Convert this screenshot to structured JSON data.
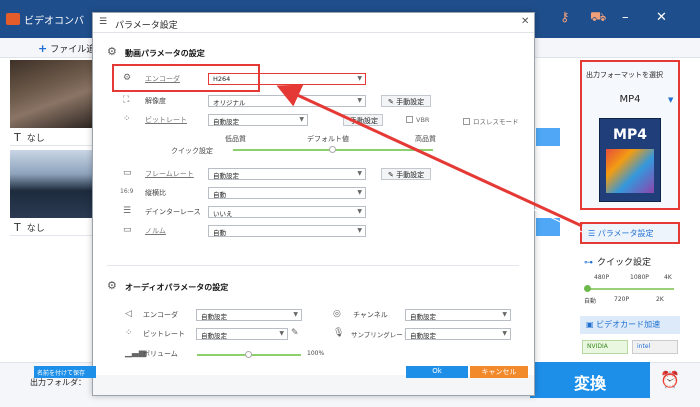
{
  "app": {
    "title": "ビデオコンバ",
    "add_file": "ファイル追",
    "item_label": "なし",
    "t_glyph": "T",
    "output_folder": "出力フォルダ："
  },
  "right_panel": {
    "format_label": "出力フォーマットを選択",
    "format_value": "MP4",
    "format_icon_text": "MP4",
    "param_button": "パラメータ設定",
    "quick_label": "クイック設定",
    "quick_top": [
      "480P",
      "1080P",
      "4K"
    ],
    "quick_bottom": [
      "自動",
      "720P",
      "2K"
    ],
    "accel_label": "ビデオカード加速",
    "gpu1": "NVIDIA",
    "gpu2": "intel",
    "convert": "変換"
  },
  "dialog": {
    "title": "パラメータ設定",
    "video_section": "動画パラメータの設定",
    "rows": [
      {
        "label": "エンコーダ",
        "value": "H264"
      },
      {
        "label": "解像度",
        "value": "オリジナル"
      },
      {
        "label": "ビットレート",
        "value": "自動設定"
      },
      {
        "label": "フレームレート",
        "value": "自動設定"
      },
      {
        "label": "縦横比",
        "value": "自動"
      },
      {
        "label": "デインターレース",
        "value": "いいえ"
      },
      {
        "label": "ノルム",
        "value": "自動"
      }
    ],
    "manual_btn": "手動設定",
    "vbr": "VBR",
    "lossless": "ロスレスモード",
    "quick": {
      "low": "低品質",
      "default": "デフォルト値",
      "high": "高品質",
      "label": "クイック設定"
    },
    "aspect_icon": "16:9",
    "audio_section": "オーディオパラメータの設定",
    "audio": {
      "encoder_label": "エンコーダ",
      "encoder_value": "自動設定",
      "bitrate_label": "ビットレート",
      "bitrate_value": "自動設定",
      "volume_label": "ボリューム",
      "volume_value": "100%",
      "channel_label": "チャンネル",
      "channel_value": "自動設定",
      "sampling_label": "サンプリングレート",
      "sampling_value": "自動設定"
    },
    "save_btn": "名前を付けて保存",
    "ok_btn": "Ok",
    "cancel_btn": "キャンセル"
  }
}
